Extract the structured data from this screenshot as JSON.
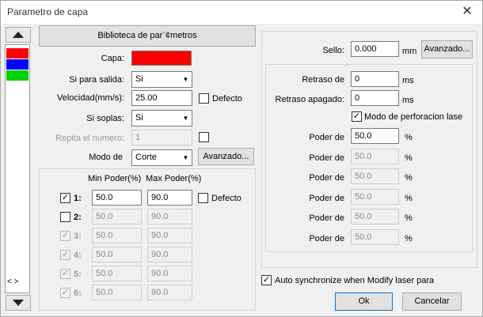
{
  "window": {
    "title": "Parametro de capa",
    "close_glyph": "✕"
  },
  "layers": {
    "colors": [
      "#ff0000",
      "#0000ff",
      "#00d000"
    ],
    "scroll_glyph": "< >"
  },
  "library_button": "Biblioteca de par¨¢metros",
  "left": {
    "capa_label": "Capa:",
    "capa_color": "#ff0000",
    "salida_label": "Si para salida:",
    "salida_value": "Si",
    "velocidad_label": "Velocidad(mm/s):",
    "velocidad_value": "25.00",
    "defecto_label": "Defecto",
    "soplas_label": "Si soplas:",
    "soplas_value": "Si",
    "repita_label": "Repita el numero:",
    "repita_value": "1",
    "modo_label": "Modo de",
    "modo_value": "Corte",
    "avanzado_label": "Avanzado...",
    "power_header_min": "Min Poder(%)",
    "power_header_max": "Max Poder(%)",
    "power_defecto_label": "Defecto",
    "power_rows": [
      {
        "check": "✓",
        "label": "1:",
        "min": "50.0",
        "max": "90.0"
      },
      {
        "check": "",
        "label": "2:",
        "min": "50.0",
        "max": "90.0"
      },
      {
        "check": "✓",
        "label": "3:",
        "min": "50.0",
        "max": "90.0"
      },
      {
        "check": "✓",
        "label": "4:",
        "min": "50.0",
        "max": "90.0"
      },
      {
        "check": "✓",
        "label": "5:",
        "min": "50.0",
        "max": "90.0"
      },
      {
        "check": "✓",
        "label": "6:",
        "min": "50.0",
        "max": "90.0"
      }
    ]
  },
  "right": {
    "sello_label": "Sello:",
    "sello_value": "0.000",
    "sello_unit": "mm",
    "avanzado_label": "Avanzado...",
    "retraso_de_label": "Retraso de",
    "retraso_de_value": "0",
    "retraso_apagado_label": "Retraso apagado:",
    "retraso_apagado_value": "0",
    "ms_unit": "ms",
    "modo_perforacion_check": "✓",
    "modo_perforacion_label": "Modo de perforacion lase",
    "poder_label": "Poder de",
    "percent_unit": "%",
    "poder_values": [
      "50.0",
      "50.0",
      "50.0",
      "50.0",
      "50.0",
      "50.0"
    ]
  },
  "footer": {
    "auto_sync_check": "✓",
    "auto_sync_label": "Auto synchronize when Modify laser para",
    "ok_label": "Ok",
    "cancel_label": "Cancelar"
  }
}
